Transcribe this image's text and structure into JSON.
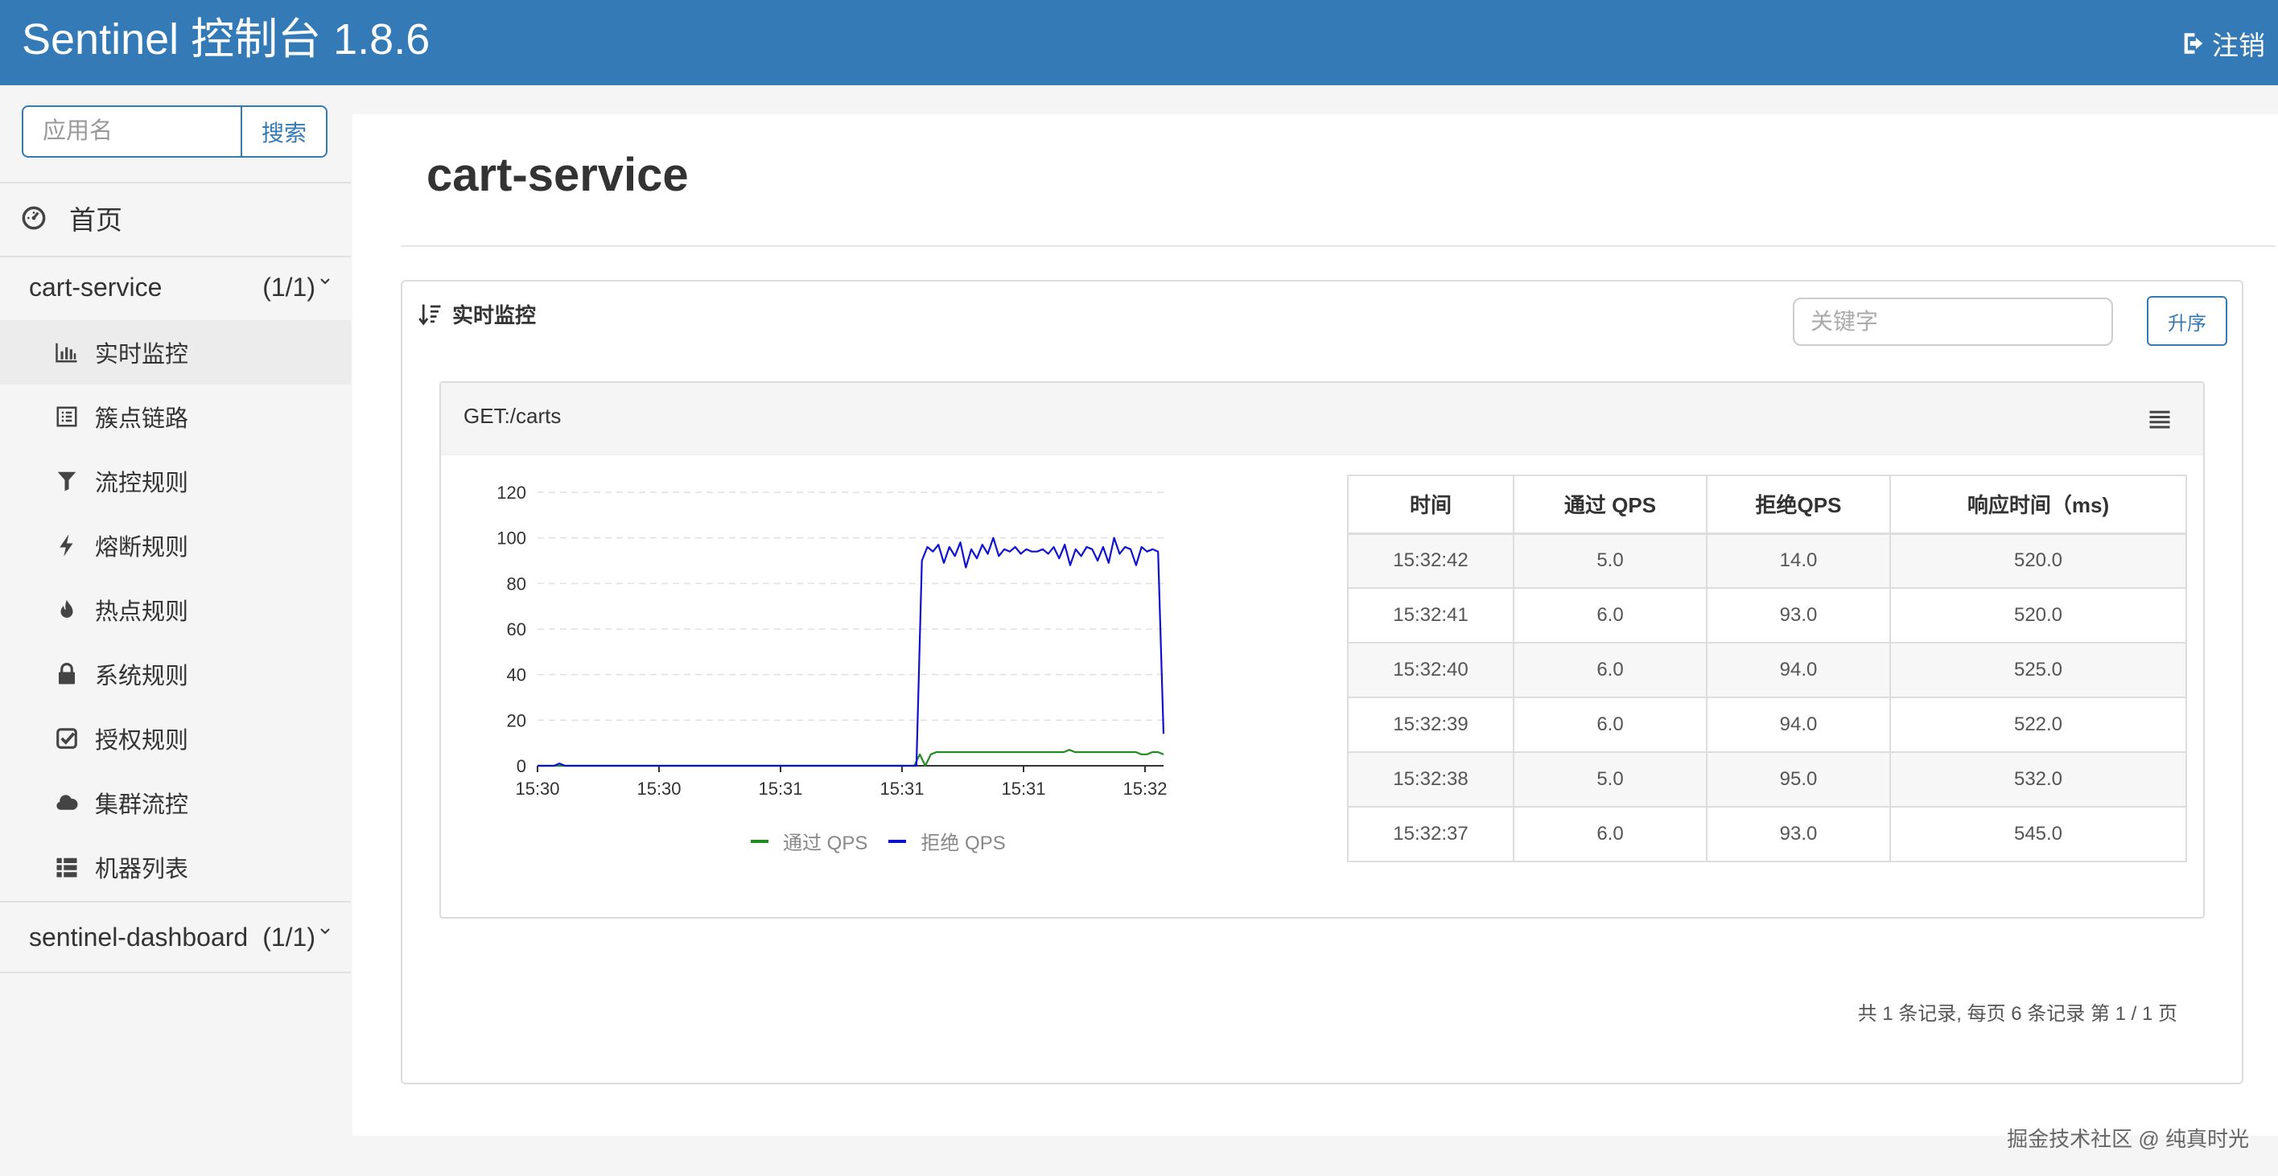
{
  "header": {
    "title": "Sentinel 控制台 1.8.6",
    "logout_label": "注销"
  },
  "sidebar": {
    "search": {
      "placeholder": "应用名",
      "button_label": "搜索"
    },
    "home_label": "首页",
    "apps": [
      {
        "name": "cart-service",
        "count": "(1/1)"
      },
      {
        "name": "sentinel-dashboard",
        "count": "(1/1)"
      }
    ],
    "menu": [
      {
        "label": "实时监控",
        "icon": "bar-chart-icon"
      },
      {
        "label": "簇点链路",
        "icon": "list-alt-icon"
      },
      {
        "label": "流控规则",
        "icon": "filter-icon"
      },
      {
        "label": "熔断规则",
        "icon": "lightning-icon"
      },
      {
        "label": "热点规则",
        "icon": "fire-icon"
      },
      {
        "label": "系统规则",
        "icon": "lock-icon"
      },
      {
        "label": "授权规则",
        "icon": "check-icon"
      },
      {
        "label": "集群流控",
        "icon": "cloud-icon"
      },
      {
        "label": "机器列表",
        "icon": "th-list-icon"
      }
    ]
  },
  "main": {
    "title": "cart-service",
    "panel": {
      "title": "实时监控",
      "keyword_placeholder": "关键字",
      "sort_label": "升序"
    },
    "resource": {
      "name": "GET:/carts",
      "table": {
        "headers": [
          "时间",
          "通过 QPS",
          "拒绝QPS",
          "响应时间（ms)"
        ],
        "rows": [
          [
            "15:32:42",
            "5.0",
            "14.0",
            "520.0"
          ],
          [
            "15:32:41",
            "6.0",
            "93.0",
            "520.0"
          ],
          [
            "15:32:40",
            "6.0",
            "94.0",
            "525.0"
          ],
          [
            "15:32:39",
            "6.0",
            "94.0",
            "522.0"
          ],
          [
            "15:32:38",
            "5.0",
            "95.0",
            "532.0"
          ],
          [
            "15:32:37",
            "6.0",
            "93.0",
            "545.0"
          ]
        ]
      }
    },
    "pager_text": "共 1 条记录, 每页 6 条记录 第 1 / 1 页"
  },
  "watermark": "掘金技术社区 @ 纯真时光",
  "colors": {
    "primary": "#337ab7",
    "pass": "#228b22",
    "block": "#1010d0"
  },
  "chart_data": {
    "type": "line",
    "ylim": [
      0,
      120
    ],
    "yticks": [
      "120",
      "100",
      "80",
      "60",
      "40",
      "20",
      "0"
    ],
    "x_tick_labels": [
      "15:30",
      "15:30",
      "15:31",
      "15:31",
      "15:31",
      "15:32"
    ],
    "legend_position": "bottom",
    "grid": true,
    "series": [
      {
        "name": "通过 QPS",
        "color": "#228b22",
        "values": [
          0,
          0,
          0,
          0,
          0,
          0,
          0,
          0,
          0,
          0,
          0,
          0,
          0,
          0,
          0,
          0,
          0,
          0,
          0,
          0,
          0,
          0,
          0,
          0,
          0,
          0,
          0,
          0,
          0,
          0,
          0,
          0,
          0,
          0,
          0,
          0,
          0,
          0,
          0,
          0,
          0,
          0,
          0,
          0,
          0,
          0,
          0,
          0,
          0,
          0,
          0,
          0,
          0,
          0,
          0,
          0,
          0,
          0,
          0,
          0,
          0,
          0,
          0,
          0,
          0,
          0,
          0,
          0,
          0,
          5,
          0,
          5,
          6,
          6,
          6,
          6,
          6,
          6,
          6,
          6,
          6,
          6,
          6,
          6,
          6,
          6,
          6,
          6,
          6,
          6,
          6,
          6,
          6,
          6,
          6,
          6,
          7,
          6,
          6,
          6,
          6,
          6,
          6,
          6,
          6,
          6,
          6,
          6,
          6,
          5,
          5,
          6,
          6,
          5
        ]
      },
      {
        "name": "拒绝 QPS",
        "color": "#1010d0",
        "values": [
          0,
          0,
          0,
          0,
          1,
          0,
          0,
          0,
          0,
          0,
          0,
          0,
          0,
          0,
          0,
          0,
          0,
          0,
          0,
          0,
          0,
          0,
          0,
          0,
          0,
          0,
          0,
          0,
          0,
          0,
          0,
          0,
          0,
          0,
          0,
          0,
          0,
          0,
          0,
          0,
          0,
          0,
          0,
          0,
          0,
          0,
          0,
          0,
          0,
          0,
          0,
          0,
          0,
          0,
          0,
          0,
          0,
          0,
          0,
          0,
          0,
          0,
          0,
          0,
          0,
          0,
          0,
          0,
          0,
          0,
          90,
          96,
          94,
          97,
          89,
          96,
          92,
          98,
          87,
          95,
          91,
          97,
          93,
          100,
          92,
          95,
          94,
          96,
          93,
          95,
          94,
          94,
          95,
          93,
          96,
          91,
          97,
          88,
          95,
          92,
          96,
          95,
          90,
          96,
          89,
          100,
          93,
          96,
          95,
          88,
          96,
          94,
          95,
          94,
          14
        ]
      }
    ]
  }
}
